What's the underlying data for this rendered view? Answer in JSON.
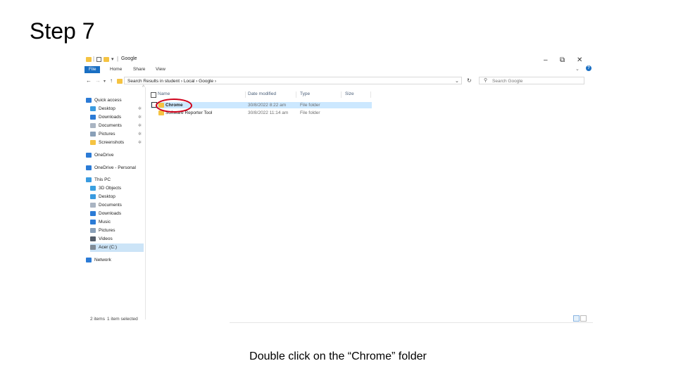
{
  "slide": {
    "title": "Step 7",
    "caption": "Double click on the  “Chrome” folder"
  },
  "window": {
    "title": "Google",
    "controls": {
      "minimize": "–",
      "restore": "⧉",
      "close": "✕"
    },
    "ribbon_tabs": [
      "File",
      "Home",
      "Share",
      "View"
    ],
    "help": "?"
  },
  "address_bar": {
    "path": "Search Results in student  ›  Local  ›  Google  ›",
    "search_placeholder": "Search Google"
  },
  "sidebar": {
    "items": [
      {
        "label": "Quick access",
        "icon": "star-icon",
        "color": "#2b7bd6",
        "pinned": false
      },
      {
        "label": "Desktop",
        "icon": "desktop-icon",
        "color": "#3a9be0",
        "pinned": true
      },
      {
        "label": "Downloads",
        "icon": "download-arrow-icon",
        "color": "#2b7bd6",
        "pinned": true
      },
      {
        "label": "Documents",
        "icon": "document-icon",
        "color": "#a9b4c2",
        "pinned": true
      },
      {
        "label": "Pictures",
        "icon": "picture-icon",
        "color": "#8aa0b8",
        "pinned": true
      },
      {
        "label": "Screenshots",
        "icon": "folder-icon",
        "color": "#f5c342",
        "pinned": true
      },
      {
        "label": "OneDrive",
        "icon": "cloud-icon",
        "color": "#2b7bd6",
        "pinned": false
      },
      {
        "label": "OneDrive - Personal",
        "icon": "cloud-icon",
        "color": "#2b7bd6",
        "pinned": false
      },
      {
        "label": "This PC",
        "icon": "computer-icon",
        "color": "#3a9be0",
        "pinned": false
      },
      {
        "label": "3D Objects",
        "icon": "cube-icon",
        "color": "#3aa0e0",
        "pinned": false
      },
      {
        "label": "Desktop",
        "icon": "desktop-icon",
        "color": "#3a9be0",
        "pinned": false
      },
      {
        "label": "Documents",
        "icon": "document-icon",
        "color": "#a9b4c2",
        "pinned": false
      },
      {
        "label": "Downloads",
        "icon": "download-arrow-icon",
        "color": "#2b7bd6",
        "pinned": false
      },
      {
        "label": "Music",
        "icon": "music-note-icon",
        "color": "#2b7bd6",
        "pinned": false
      },
      {
        "label": "Pictures",
        "icon": "picture-icon",
        "color": "#8aa0b8",
        "pinned": false
      },
      {
        "label": "Videos",
        "icon": "video-icon",
        "color": "#555e6a",
        "pinned": false
      },
      {
        "label": "Acer (C:)",
        "icon": "drive-icon",
        "color": "#7f8a96",
        "pinned": false,
        "selected": true
      },
      {
        "label": "Network",
        "icon": "network-icon",
        "color": "#2b7bd6",
        "pinned": false
      }
    ],
    "pin_glyph": "✲"
  },
  "file_list": {
    "columns": [
      "Name",
      "Date modified",
      "Type",
      "Size"
    ],
    "rows": [
      {
        "name": "Chrome",
        "date": "30/8/2022 8:22 am",
        "type": "File folder",
        "size": "",
        "selected": true
      },
      {
        "name": "Software Reporter Tool",
        "date": "30/8/2022 11:14 am",
        "type": "File folder",
        "size": "",
        "selected": false
      }
    ]
  },
  "status_bar": {
    "count": "2 items",
    "selection": "1 item selected"
  },
  "colors": {
    "accent": "#1a6fc3",
    "selection": "#cce8ff",
    "highlight_ring": "#d0021b"
  }
}
